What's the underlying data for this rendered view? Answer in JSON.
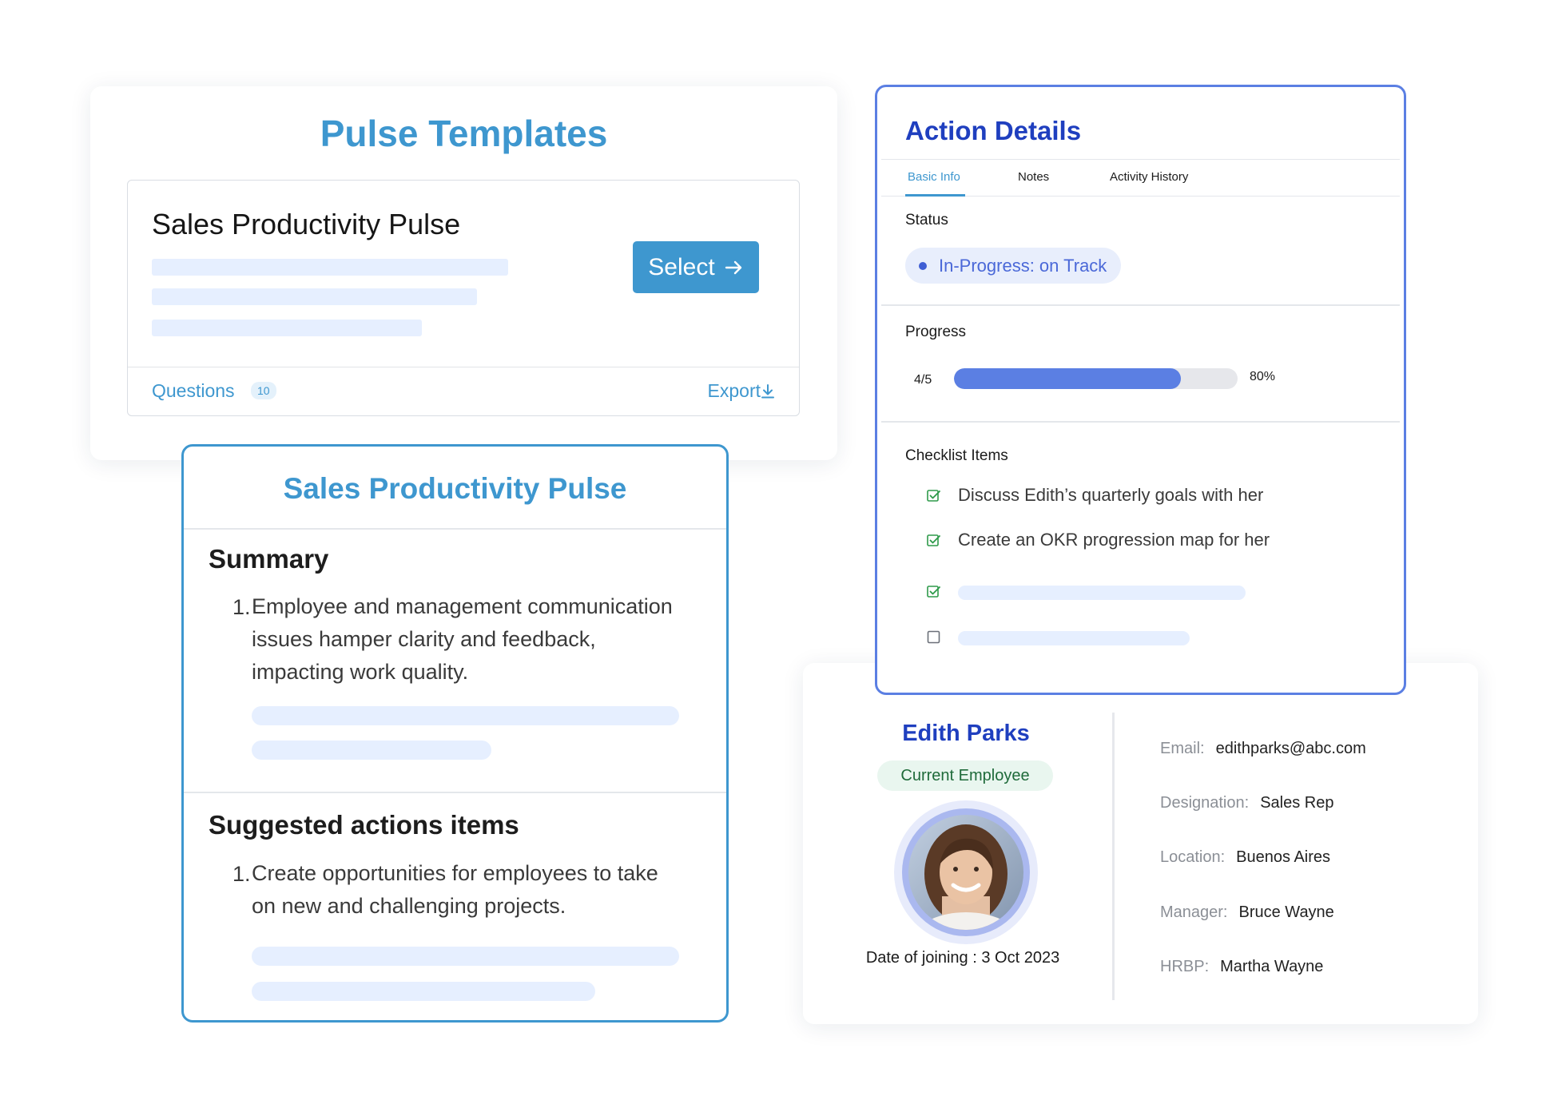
{
  "pulse_templates": {
    "title": "Pulse Templates",
    "card_title": "Sales Productivity Pulse",
    "select_label": "Select",
    "select_icon": "arrow-right-icon",
    "questions_label": "Questions",
    "questions_count": "10",
    "export_label": "Export",
    "export_icon": "download-icon"
  },
  "pulse_summary": {
    "title": "Sales Productivity Pulse",
    "summary_heading": "Summary",
    "summary_items": [
      {
        "num": "1.",
        "text": "Employee and management communication issues hamper clarity and feedback, impacting work quality."
      }
    ],
    "actions_heading": "Suggested actions items",
    "action_items": [
      {
        "num": "1.",
        "text": "Create opportunities for employees to take on new and challenging projects."
      }
    ]
  },
  "action_details": {
    "title": "Action Details",
    "tabs": [
      "Basic Info",
      "Notes",
      "Activity History"
    ],
    "active_tab": "Basic Info",
    "status_label": "Status",
    "status_value": "In-Progress: on Track",
    "progress_label": "Progress",
    "progress_fraction": "4/5",
    "progress_percent": "80%",
    "progress_value": 0.8,
    "checklist_label": "Checklist Items",
    "checklist": [
      {
        "text": "Discuss Edith’s quarterly goals with her",
        "checked": true
      },
      {
        "text": "Create an OKR progression map for her",
        "checked": true
      },
      {
        "text": "",
        "checked": true
      },
      {
        "text": "",
        "checked": false
      }
    ]
  },
  "employee": {
    "name": "Edith Parks",
    "status": "Current Employee",
    "joining": "Date of joining : 3 Oct 2023",
    "fields": [
      {
        "key": "Email:",
        "value": "edithparks@abc.com"
      },
      {
        "key": "Designation:",
        "value": "Sales Rep"
      },
      {
        "key": "Location:",
        "value": "Buenos Aires"
      },
      {
        "key": "Manager:",
        "value": "Bruce Wayne"
      },
      {
        "key": "HRBP:",
        "value": "Martha Wayne"
      }
    ]
  },
  "colors": {
    "brand_blue": "#3e97cf",
    "action_blue": "#1f3fbf",
    "progress_blue": "#5b7fe3",
    "check_green": "#2e9a4a",
    "skeleton": "#e6efff"
  }
}
